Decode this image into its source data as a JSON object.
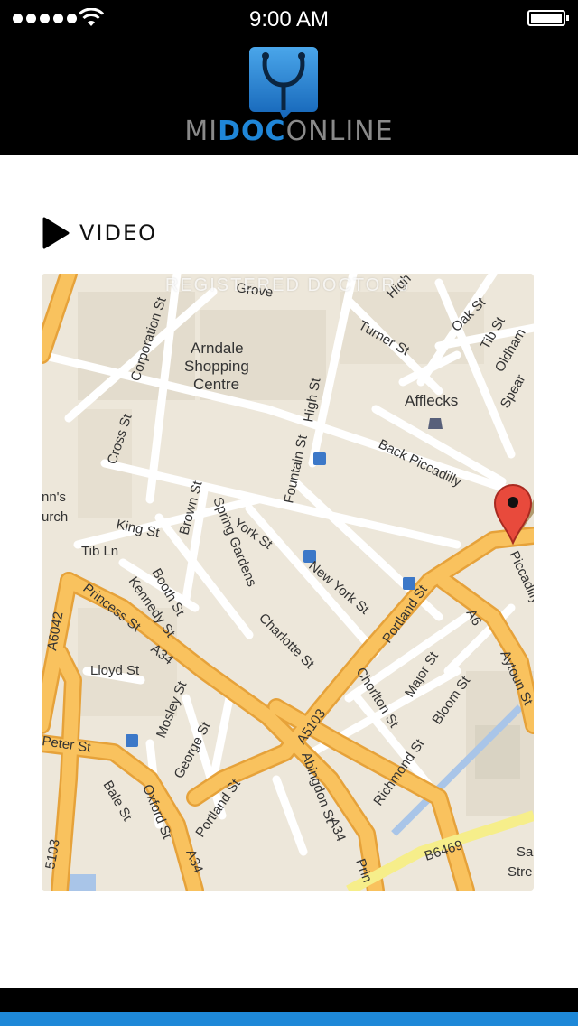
{
  "status_bar": {
    "time": "9:00 AM"
  },
  "header": {
    "logo": {
      "mi": "MI",
      "doc": "DOC",
      "online": "ONLINE"
    }
  },
  "section": {
    "label": "VIDEO",
    "icon": "play-icon"
  },
  "map": {
    "watermark": "REGISTERED DOCTORS",
    "labels": {
      "arndale_1": "Arndale",
      "arndale_2": "Shopping",
      "arndale_3": "Centre",
      "afflecks": "Afflecks",
      "grove": "Grove",
      "corporation_st": "Corporation St",
      "cross_st": "Cross St",
      "high_st": "High St",
      "fountain_st": "Fountain St",
      "turner_st": "Turner St",
      "oak_st": "Oak St",
      "tib_st_top": "Tib St",
      "oldham": "Oldham",
      "spear": "Spear",
      "high_top": "High",
      "back_piccadilly": "Back Piccadilly",
      "king_st": "King St",
      "brown_st": "Brown St",
      "spring_gardens": "Spring Gardens",
      "york_st": "York St",
      "new_york_st": "New York St",
      "tib_ln": "Tib Ln",
      "booth_st": "Booth St",
      "kennedy_st": "Kennedy St",
      "princess_st": "Princess St",
      "a34_top": "A34",
      "charlotte_st": "Charlotte St",
      "portland_st_top": "Portland St",
      "a6": "A6",
      "aytoun_st": "Aytoun St",
      "piccadilly": "Piccadilly",
      "lloyd_st": "Lloyd St",
      "a6042": "A6042",
      "mosley_st": "Mosley St",
      "george_st": "George St",
      "chorlton_st": "Chorlton St",
      "major_st": "Major St",
      "bloom_st": "Bloom St",
      "a5103_mid": "A5103",
      "peter_st": "Peter St",
      "oxford_st": "Oxford St",
      "portland_st_bottom": "Portland St",
      "abingdon_st": "Abingdon St",
      "richmond_st": "Richmond St",
      "a34_bottom": "A34",
      "a34_left": "A34",
      "bale_st": "Bale St",
      "a5103_left": "5103",
      "b6469": "B6469",
      "ann_church_1": "nn's",
      "ann_church_2": "urch",
      "sa": "Sa",
      "stre": "Stre",
      "prin": "Prin"
    }
  },
  "colors": {
    "brand_blue": "#1e88d8",
    "road_major": "#f9b648",
    "road_minor": "#ffffff",
    "map_bg": "#ede7da",
    "marker": "#e84a3c"
  }
}
